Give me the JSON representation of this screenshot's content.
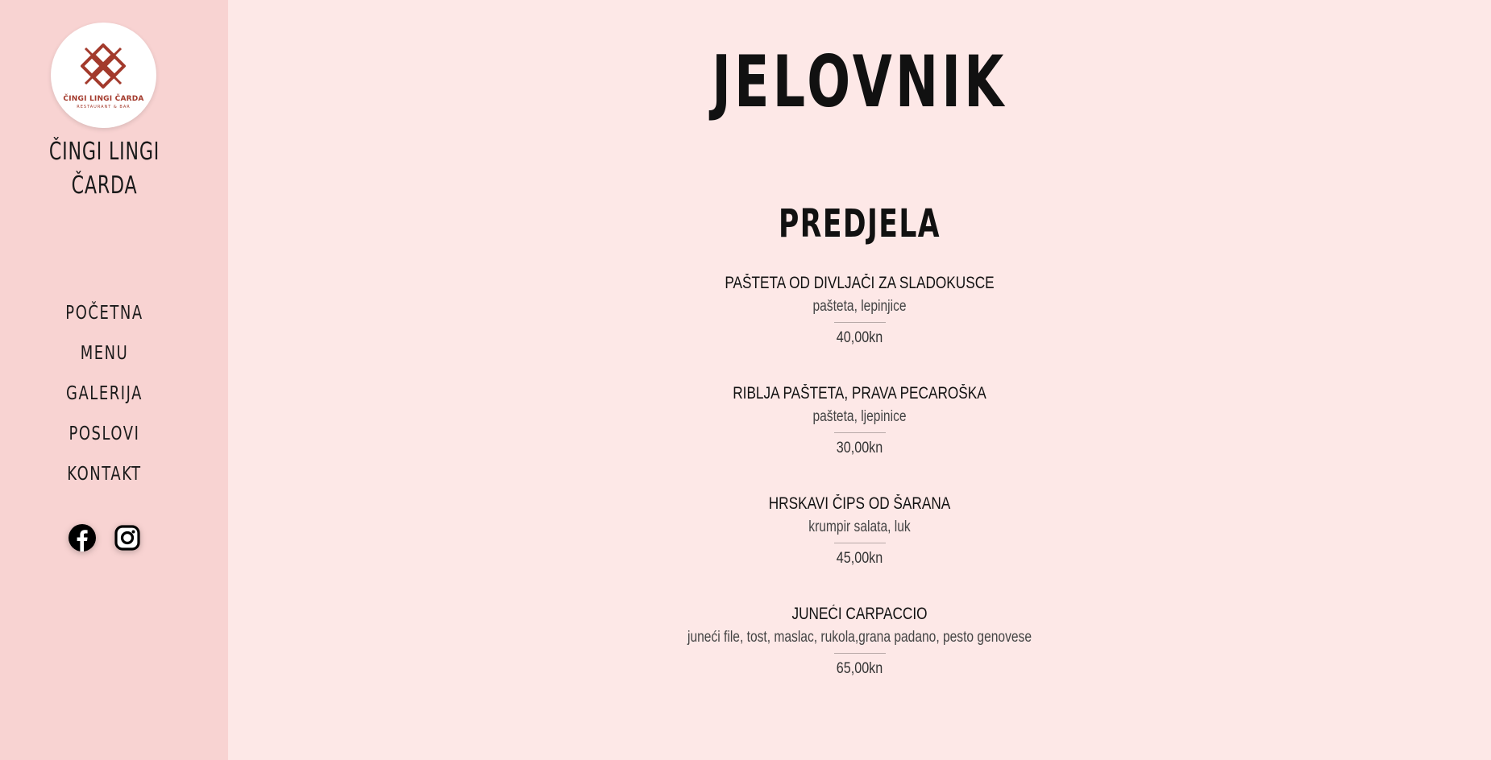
{
  "brand": {
    "logo_text": "ČINGI LINGI ČARDA",
    "logo_subtext": "RESTAURANT & BAR",
    "name_line1": "ČINGI LINGI",
    "name_line2": "ČARDA",
    "accent_color": "#a33a2c"
  },
  "nav": {
    "items": [
      {
        "label": "POČETNA"
      },
      {
        "label": "MENU"
      },
      {
        "label": "GALERIJA"
      },
      {
        "label": "POSLOVI"
      },
      {
        "label": "KONTAKT"
      }
    ]
  },
  "social": {
    "icons": [
      "facebook-icon",
      "instagram-icon"
    ]
  },
  "main": {
    "title": "JELOVNIK",
    "section": "PREDJELA",
    "items": [
      {
        "name": "PAŠTETA OD DIVLJAČI ZA SLADOKUSCE",
        "desc": "pašteta, lepinjice",
        "price": "40,00kn"
      },
      {
        "name": "RIBLJA PAŠTETA, PRAVA PECAROŠKA",
        "desc": "pašteta, ljepinice",
        "price": "30,00kn"
      },
      {
        "name": "HRSKAVI ČIPS OD ŠARANA",
        "desc": "krumpir salata, luk",
        "price": "45,00kn"
      },
      {
        "name": "JUNEĆI CARPACCIO",
        "desc": "juneći file, tost, maslac, rukola,grana padano, pesto genovese",
        "price": "65,00kn"
      }
    ]
  }
}
